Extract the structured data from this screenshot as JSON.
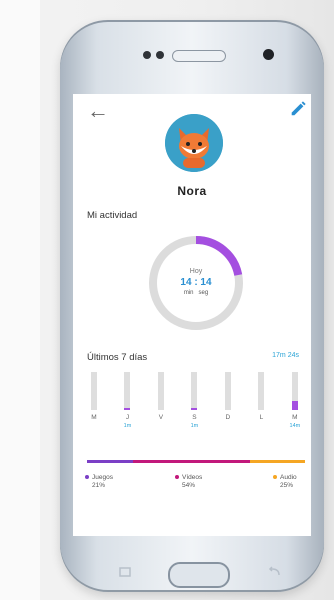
{
  "profile": {
    "name": "Nora"
  },
  "activity": {
    "section_title": "Mi actividad",
    "today_label": "Hoy",
    "time_value": "14 : 14",
    "units_label": "min   seg",
    "ring_progress": 0.22
  },
  "week": {
    "title": "Últimos 7 días",
    "total": "17m 24s",
    "days": [
      {
        "label": "M",
        "value": "",
        "level": 0
      },
      {
        "label": "J",
        "value": "1m",
        "level": 0.05
      },
      {
        "label": "V",
        "value": "",
        "level": 0
      },
      {
        "label": "S",
        "value": "1m",
        "level": 0.05
      },
      {
        "label": "D",
        "value": "",
        "level": 0
      },
      {
        "label": "L",
        "value": "",
        "level": 0
      },
      {
        "label": "M",
        "value": "14m",
        "level": 0.25
      }
    ]
  },
  "breakdown": [
    {
      "label": "Juegos",
      "percent": "21%",
      "color": "#7b3fc6",
      "share": 0.21
    },
    {
      "label": "Vídeos",
      "percent": "54%",
      "color": "#c2187b",
      "share": 0.54
    },
    {
      "label": "Audio",
      "percent": "25%",
      "color": "#f5a623",
      "share": 0.25
    }
  ],
  "colors": {
    "accent": "#2a8fd1",
    "ring": "#a44fe0"
  }
}
